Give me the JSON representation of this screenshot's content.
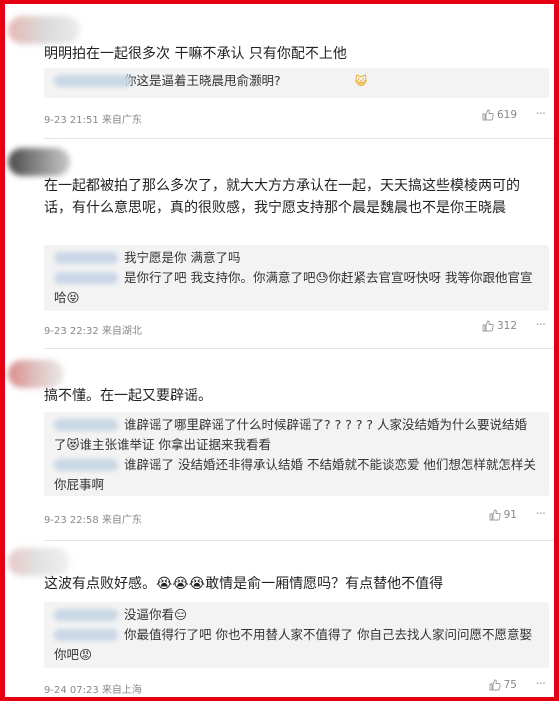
{
  "comments": [
    {
      "text": "明明拍在一起很多次 干嘛不承认 只有你配不上他",
      "replies": [
        {
          "text": "你这是逼着王晓晨甩俞灏明? ",
          "emoji": "😺"
        }
      ],
      "meta": "9-23 21:51 来自广东",
      "likes": "619",
      "more": "···"
    },
    {
      "text": "在一起都被拍了那么多次了，就大大方方承认在一起，天天搞这些模棱两可的话，有什么意思呢，真的很败感，我宁愿支持那个晨是魏晨也不是你王晓晨",
      "replies": [
        {
          "text": "我宁愿是你 满意了吗",
          "emoji": ""
        },
        {
          "text": "是你行了吧 我支持你。你满意了吧😓你赶紧去官宣呀快呀 我等你跟他官宣哈😝",
          "emoji": ""
        }
      ],
      "meta": "9-23 22:32 来自湖北",
      "likes": "312",
      "more": "···"
    },
    {
      "text": "搞不懂。在一起又要辟谣。",
      "replies": [
        {
          "text": "谁辟谣了哪里辟谣了什么时候辟谣了? ? ? ? ? 人家没结婚为什么要说结婚了😻谁主张谁举证 你拿出证据来我看看",
          "emoji": ""
        },
        {
          "text": "谁辟谣了 没结婚还非得承认结婚 不结婚就不能谈恋爱 他们想怎样就怎样关你屁事啊",
          "emoji": ""
        }
      ],
      "meta": "9-23 22:58 来自广东",
      "likes": "91",
      "more": "···"
    },
    {
      "text": "这波有点败好感。😭😭😭敢情是俞一厢情愿吗？有点替他不值得",
      "replies": [
        {
          "text": "没逼你看😑",
          "emoji": ""
        },
        {
          "text": "你最值得行了吧 你也不用替人家不值得了 你自己去找人家问问愿不愿意娶你吧😡",
          "emoji": ""
        }
      ],
      "meta": "9-24 07:23 来自上海",
      "likes": "75",
      "more": "···"
    }
  ],
  "colors": {
    "frame": "#e60012",
    "reply_bg": "#f3f3f3"
  }
}
